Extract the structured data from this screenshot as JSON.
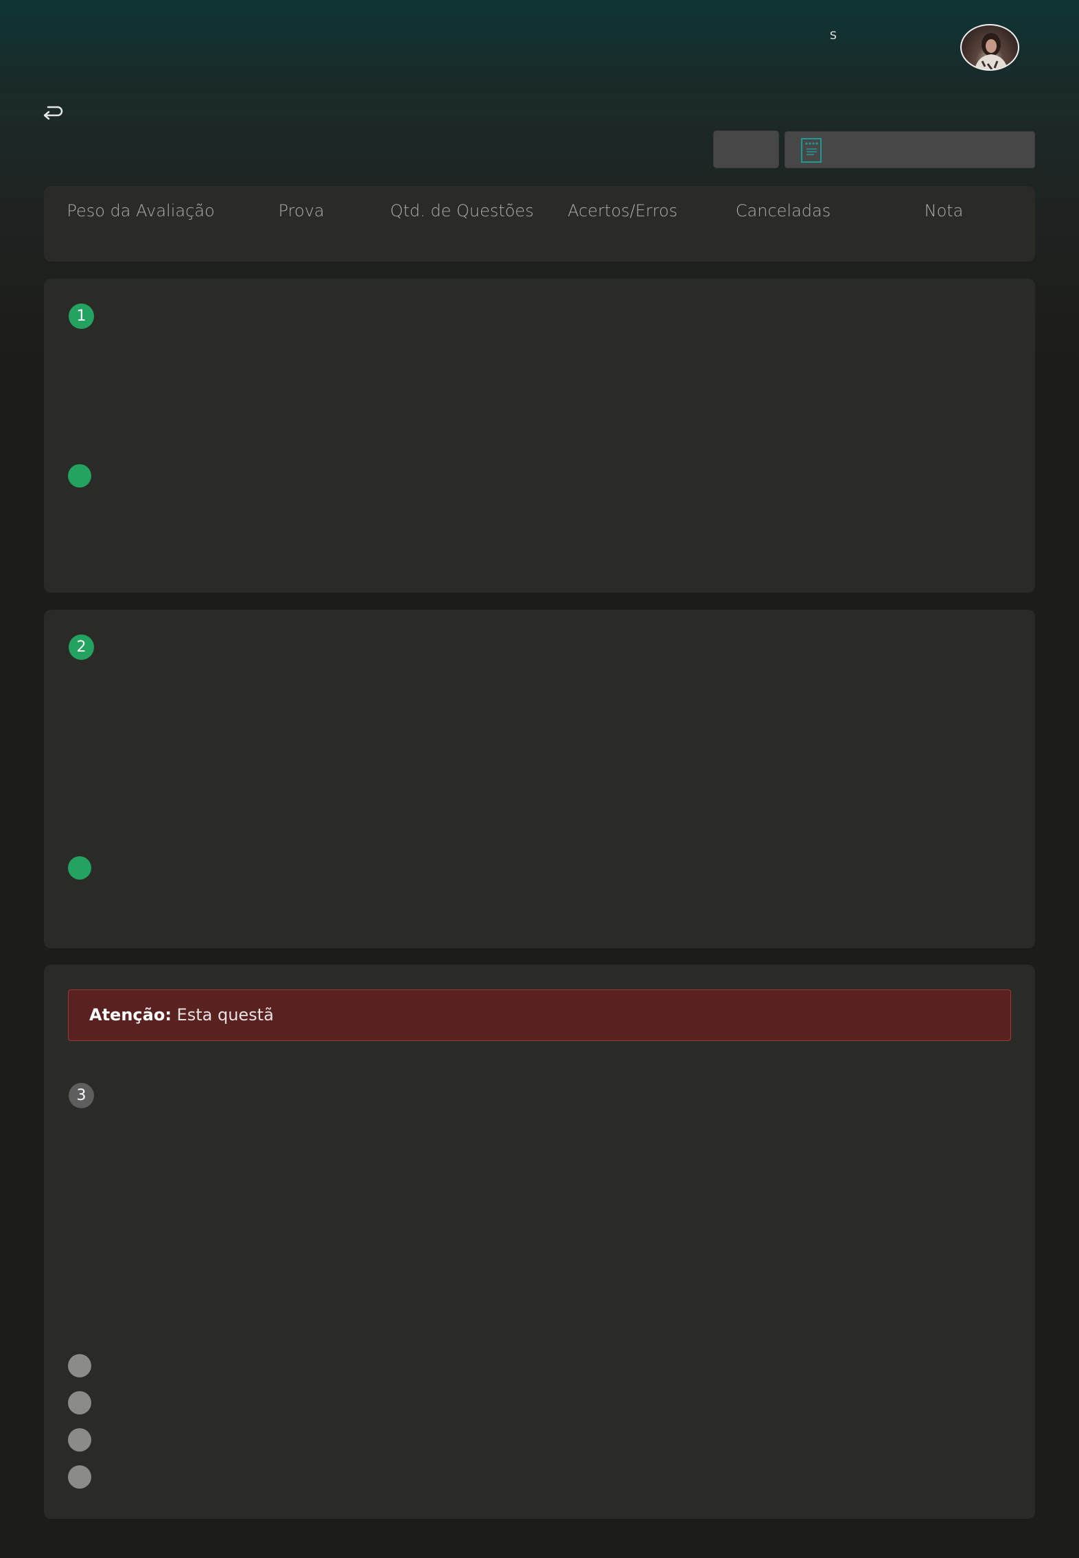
{
  "header": {
    "user_initial": "S",
    "avatar_icon": "profile-photo"
  },
  "nav": {
    "back_icon": "return-arrow-icon",
    "document_icon": "document-icon"
  },
  "summary": {
    "columns": [
      "Peso da Avaliação",
      "Prova",
      "Qtd. de Questões",
      "Acertos/Erros",
      "Canceladas",
      "Nota"
    ]
  },
  "questions": [
    {
      "number": "1",
      "status_color": "#23a35f"
    },
    {
      "number": "2",
      "status_color": "#23a35f"
    },
    {
      "number": "3",
      "status_color": "#5e5e5e"
    }
  ],
  "alert": {
    "label": "Atenção:",
    "text": " Esta questã"
  },
  "colors": {
    "accent": "#23a35f",
    "alert_bg": "#5a2121",
    "header_bg": "#0f3535"
  }
}
